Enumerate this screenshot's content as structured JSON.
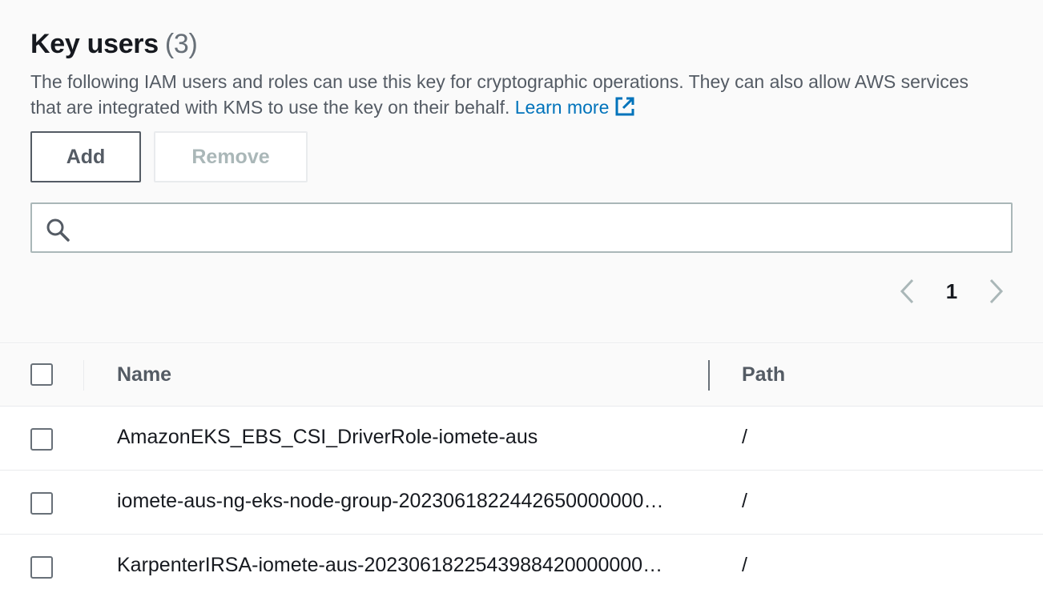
{
  "section": {
    "title": "Key users",
    "count": "(3)",
    "description": "The following IAM users and roles can use this key for cryptographic operations. They can also allow AWS services that are integrated with KMS to use the key on their behalf.",
    "learn_more": "Learn more"
  },
  "buttons": {
    "add": "Add",
    "remove": "Remove"
  },
  "search": {
    "value": "",
    "placeholder": ""
  },
  "pagination": {
    "current_page": "1"
  },
  "table": {
    "columns": [
      "Name",
      "Path"
    ],
    "rows": [
      {
        "name": "AmazonEKS_EBS_CSI_DriverRole-iomete-aus",
        "path": "/"
      },
      {
        "name": "iomete-aus-ng-eks-node-group-2023061822442650000000001",
        "path": "/"
      },
      {
        "name": "KarpenterIRSA-iomete-aus-2023061822543988420000000002",
        "path": "/"
      }
    ]
  },
  "colors": {
    "link": "#0073bb",
    "text": "#16191f",
    "muted": "#545b64",
    "disabled": "#aab7b8",
    "header_bg": "#fafafa"
  },
  "icons": {
    "external_link": "external-link-icon",
    "search": "search-icon",
    "prev": "chevron-left-icon",
    "next": "chevron-right-icon"
  }
}
